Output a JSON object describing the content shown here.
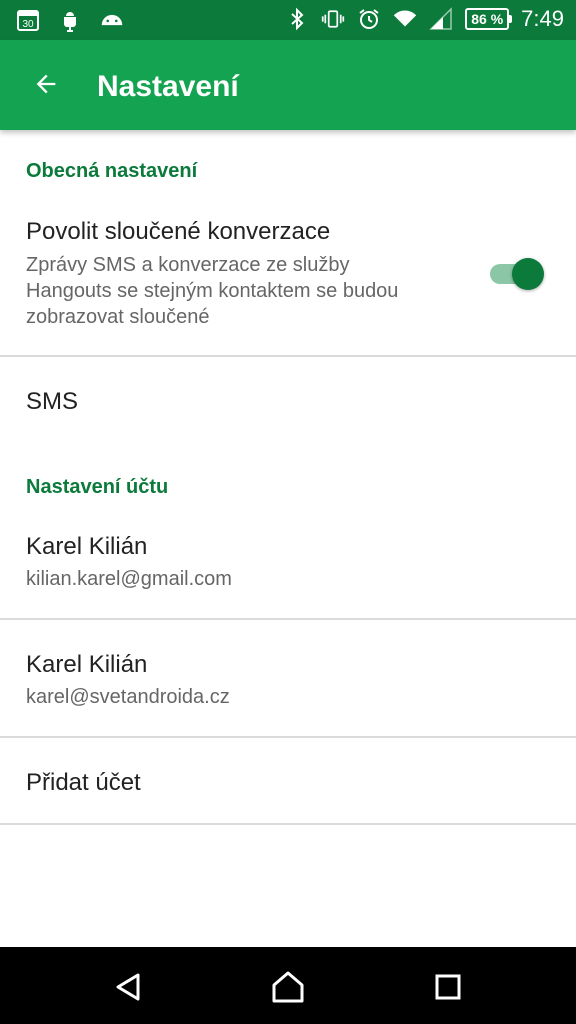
{
  "statusbar": {
    "calendar_day": "30",
    "battery": "86 %",
    "time": "7:49",
    "icons": [
      "calendar-icon",
      "android-debug-icon",
      "android-head-icon",
      "bluetooth-icon",
      "vibrate-icon",
      "alarm-icon",
      "wifi-icon",
      "signal-icon",
      "battery-icon"
    ]
  },
  "appbar": {
    "title": "Nastavení",
    "back_icon": "arrow-back-icon",
    "color": "#14a350"
  },
  "general": {
    "header": "Obecná nastavení",
    "merge_title": "Povolit sloučené konverzace",
    "merge_summary_lines": [
      "Zprávy SMS a konverzace ze služby",
      "Hangouts se stejným kontaktem se budou",
      "zobrazovat sloučené"
    ],
    "merge_enabled": true
  },
  "sms": {
    "label": "SMS"
  },
  "accounts": {
    "header": "Nastavení účtu",
    "items": [
      {
        "name": "Karel Kilián",
        "email": "kilian.karel@gmail.com"
      },
      {
        "name": "Karel Kilián",
        "email": "karel@svetandroida.cz"
      }
    ],
    "add_label": "Přidat účet"
  },
  "navbar": {
    "icons": [
      "back-triangle-icon",
      "home-icon",
      "recents-icon"
    ]
  },
  "colors": {
    "statusbar": "#0b7a3b",
    "accent": "#0b7a3b"
  }
}
